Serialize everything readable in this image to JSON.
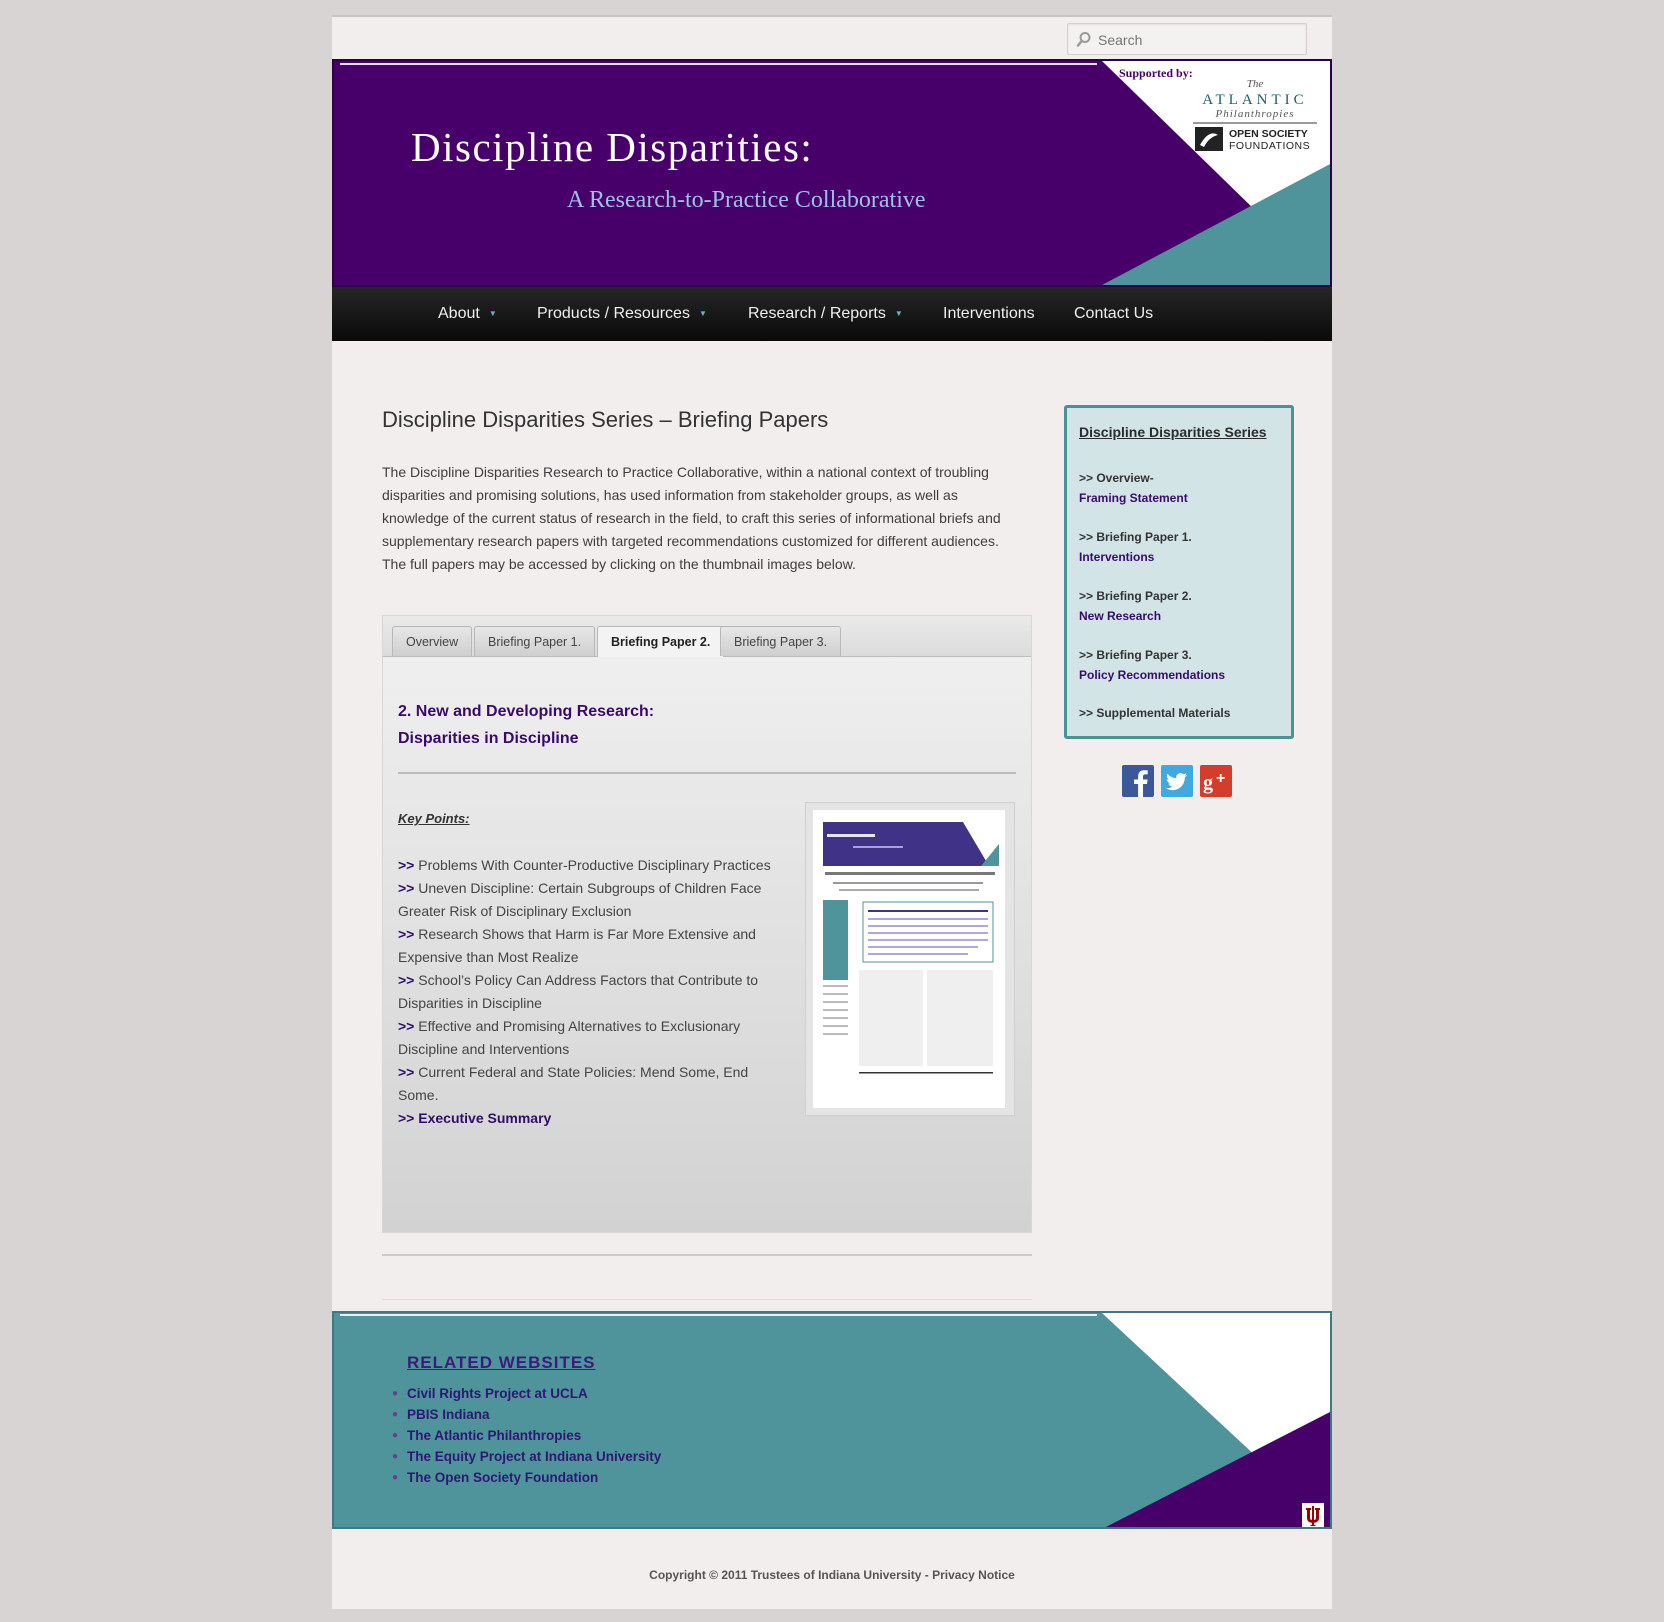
{
  "search": {
    "placeholder": "Search"
  },
  "header": {
    "title": "Discipline Disparities:",
    "subtitle": "A Research-to-Practice Collaborative",
    "supported_by": "Supported by:",
    "sponsors": [
      "The Atlantic Philanthropies",
      "Open Society Foundations"
    ],
    "colors": {
      "purple": "#47006a",
      "teal": "#4e949a"
    }
  },
  "nav": {
    "items": [
      {
        "label": "About",
        "has_dropdown": true
      },
      {
        "label": "Products / Resources",
        "has_dropdown": true
      },
      {
        "label": "Research / Reports",
        "has_dropdown": true
      },
      {
        "label": "Interventions",
        "has_dropdown": false
      },
      {
        "label": "Contact Us",
        "has_dropdown": false
      }
    ]
  },
  "main": {
    "title": "Discipline Disparities Series – Briefing Papers",
    "intro": "The Discipline Disparities Research to Practice Collaborative, within a national context of troubling disparities and promising solutions, has used information from stakeholder groups, as well as knowledge of the current status of research in the field, to craft this series of informational briefs and supplementary research papers with targeted recommendations customized for different audiences. The full papers may be accessed by clicking on the thumbnail images below.",
    "tabs": [
      {
        "label": "Overview",
        "active": false
      },
      {
        "label": "Briefing Paper 1.",
        "active": false
      },
      {
        "label": "Briefing Paper 2.",
        "active": true
      },
      {
        "label": "Briefing Paper 3.",
        "active": false
      }
    ],
    "active_panel": {
      "heading_line1": "2. New and Developing Research:",
      "heading_line2": "Disparities in Discipline",
      "key_points_label": "Key Points:",
      "arrow": ">>",
      "points": [
        "Problems With Counter-Productive Disciplinary Practices",
        "Uneven Discipline: Certain Subgroups of Children Face Greater Risk of Disciplinary Exclusion",
        "Research Shows that Harm is Far More Extensive and Expensive than Most Realize",
        "School’s Policy Can Address Factors that Contribute to Disparities in Discipline",
        "Effective and Promising Alternatives to Exclusionary Discipline and Interventions",
        "Current Federal and State Policies: Mend Some, End Some."
      ],
      "executive_summary_label": ">> Executive Summary"
    }
  },
  "sidebar": {
    "title": "Discipline Disparities Series",
    "items": [
      {
        "lead": ">> Overview-",
        "link": "Framing Statement"
      },
      {
        "lead": ">> Briefing Paper 1.",
        "link": "Interventions"
      },
      {
        "lead": ">> Briefing Paper 2.",
        "link": "New Research"
      },
      {
        "lead": ">> Briefing Paper 3.",
        "link": "Policy Recommendations"
      },
      {
        "lead": ">> Supplemental Materials",
        "link": ""
      }
    ],
    "social": [
      "facebook-icon",
      "twitter-icon",
      "google-plus-icon"
    ]
  },
  "footer": {
    "related_title": "RELATED WEBSITES",
    "links": [
      "Civil Rights Project at UCLA",
      "PBIS Indiana",
      "The Atlantic Philanthropies",
      "The Equity Project at Indiana University",
      "The Open Society Foundation"
    ],
    "copyright": "Copyright © 2011 Trustees of Indiana University -",
    "privacy": "Privacy Notice"
  }
}
